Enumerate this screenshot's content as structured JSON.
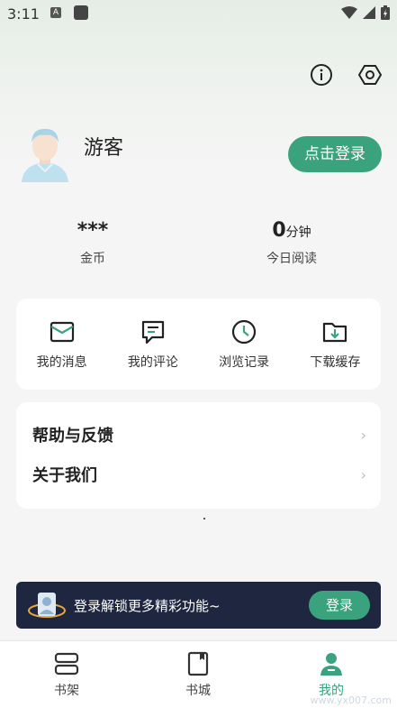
{
  "status_bar": {
    "time": "3:11",
    "a_glyph": "A"
  },
  "profile": {
    "name": "游客",
    "login_button": "点击登录"
  },
  "stats": [
    {
      "value": "***",
      "unit": "",
      "label": "金币"
    },
    {
      "value": "0",
      "unit": "分钟",
      "label": "今日阅读"
    }
  ],
  "quick_actions": [
    {
      "label": "我的消息",
      "icon": "message-icon"
    },
    {
      "label": "我的评论",
      "icon": "comment-icon"
    },
    {
      "label": "浏览记录",
      "icon": "clock-icon"
    },
    {
      "label": "下载缓存",
      "icon": "download-folder-icon"
    }
  ],
  "menu": [
    {
      "label": "帮助与反馈"
    },
    {
      "label": "关于我们"
    }
  ],
  "banner": {
    "text": "登录解锁更多精彩功能~",
    "button": "登录"
  },
  "tabbar": [
    {
      "label": "书架",
      "icon": "bookshelf-icon",
      "active": false
    },
    {
      "label": "书城",
      "icon": "bookstore-icon",
      "active": false
    },
    {
      "label": "我的",
      "icon": "profile-icon",
      "active": true
    }
  ],
  "watermark": "www.yx007.com",
  "colors": {
    "accent": "#3aa37d",
    "banner_bg": "#1f2740"
  }
}
